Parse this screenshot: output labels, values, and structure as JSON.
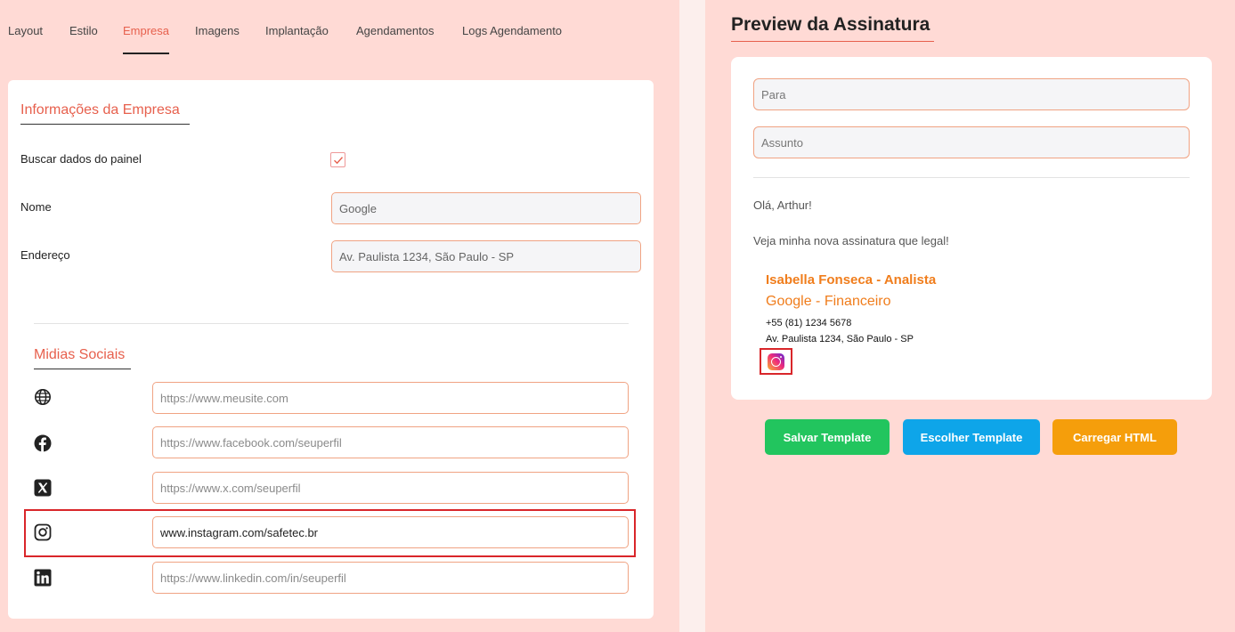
{
  "tabs": [
    {
      "label": "Layout"
    },
    {
      "label": "Estilo"
    },
    {
      "label": "Empresa"
    },
    {
      "label": "Imagens"
    },
    {
      "label": "Implantação"
    },
    {
      "label": "Agendamentos"
    },
    {
      "label": "Logs Agendamento"
    }
  ],
  "active_tab": "Empresa",
  "company": {
    "title": "Informações da Empresa",
    "fetch_label": "Buscar dados do painel",
    "fetch_checked": true,
    "name_label": "Nome",
    "name_value": "Google",
    "address_label": "Endereço",
    "address_value": "Av. Paulista 1234, São Paulo - SP"
  },
  "social": {
    "title": "Midias Sociais",
    "items": [
      {
        "icon": "globe-icon",
        "placeholder": "https://www.meusite.com",
        "value": ""
      },
      {
        "icon": "facebook-icon",
        "placeholder": "https://www.facebook.com/seuperfil",
        "value": ""
      },
      {
        "icon": "x-icon",
        "placeholder": "https://www.x.com/seuperfil",
        "value": ""
      },
      {
        "icon": "instagram-icon",
        "placeholder": "",
        "value": "www.instagram.com/safetec.br"
      },
      {
        "icon": "linkedin-icon",
        "placeholder": "https://www.linkedin.com/in/seuperfil",
        "value": ""
      }
    ]
  },
  "preview": {
    "title": "Preview da Assinatura",
    "to_placeholder": "Para",
    "subject_placeholder": "Assunto",
    "greeting": "Olá, Arthur!",
    "body": "Veja minha nova assinatura que legal!",
    "signature": {
      "name": "Isabella Fonseca - Analista",
      "role": "Google - Financeiro",
      "phone": "+55 (81) 1234 5678",
      "address": "Av. Paulista 1234, São Paulo - SP"
    }
  },
  "buttons": {
    "save": "Salvar Template",
    "choose": "Escolher Template",
    "load": "Carregar HTML"
  },
  "colors": {
    "accent": "#e7604d",
    "signature": "#f07d1c",
    "save": "#22c55e",
    "choose": "#0ea5e9",
    "load": "#f59e0b",
    "highlight": "#d9262a"
  }
}
